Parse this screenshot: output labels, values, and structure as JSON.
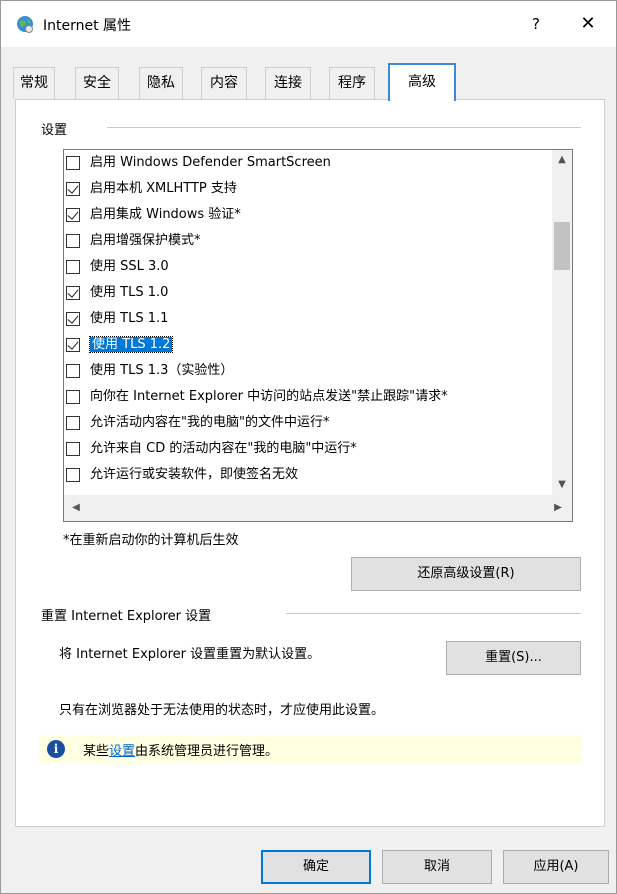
{
  "window": {
    "title": "Internet 属性",
    "help_label": "?",
    "close_label": "✕"
  },
  "tabs": [
    {
      "label": "常规",
      "active": false
    },
    {
      "label": "安全",
      "active": false
    },
    {
      "label": "隐私",
      "active": false
    },
    {
      "label": "内容",
      "active": false
    },
    {
      "label": "连接",
      "active": false
    },
    {
      "label": "程序",
      "active": false
    },
    {
      "label": "高级",
      "active": true
    }
  ],
  "settings": {
    "group_label": "设置",
    "items": [
      {
        "label": "启用 Windows Defender SmartScreen",
        "checked": false,
        "selected": false
      },
      {
        "label": "启用本机 XMLHTTP 支持",
        "checked": true,
        "selected": false
      },
      {
        "label": "启用集成 Windows 验证*",
        "checked": true,
        "selected": false
      },
      {
        "label": "启用增强保护模式*",
        "checked": false,
        "selected": false
      },
      {
        "label": "使用 SSL 3.0",
        "checked": false,
        "selected": false
      },
      {
        "label": "使用 TLS 1.0",
        "checked": true,
        "selected": false
      },
      {
        "label": "使用 TLS 1.1",
        "checked": true,
        "selected": false
      },
      {
        "label": "使用 TLS 1.2",
        "checked": true,
        "selected": true
      },
      {
        "label": "使用 TLS 1.3（实验性）",
        "checked": false,
        "selected": false
      },
      {
        "label": "向你在 Internet Explorer 中访问的站点发送\"禁止跟踪\"请求*",
        "checked": false,
        "selected": false
      },
      {
        "label": "允许活动内容在\"我的电脑\"的文件中运行*",
        "checked": false,
        "selected": false
      },
      {
        "label": "允许来自 CD 的活动内容在\"我的电脑\"中运行*",
        "checked": false,
        "selected": false
      },
      {
        "label": "允许运行或安装软件，即使签名无效",
        "checked": false,
        "selected": false
      }
    ],
    "restart_note": "*在重新启动你的计算机后生效",
    "restore_button": "还原高级设置(R)"
  },
  "reset": {
    "group_label": "重置 Internet Explorer 设置",
    "description": "将 Internet Explorer 设置重置为默认设置。",
    "reset_button": "重置(S)...",
    "warning": "只有在浏览器处于无法使用的状态时，才应使用此设置。"
  },
  "info": {
    "prefix": "某些",
    "link": "设置",
    "suffix": "由系统管理员进行管理。"
  },
  "footer": {
    "ok": "确定",
    "cancel": "取消",
    "apply": "应用(A)"
  }
}
